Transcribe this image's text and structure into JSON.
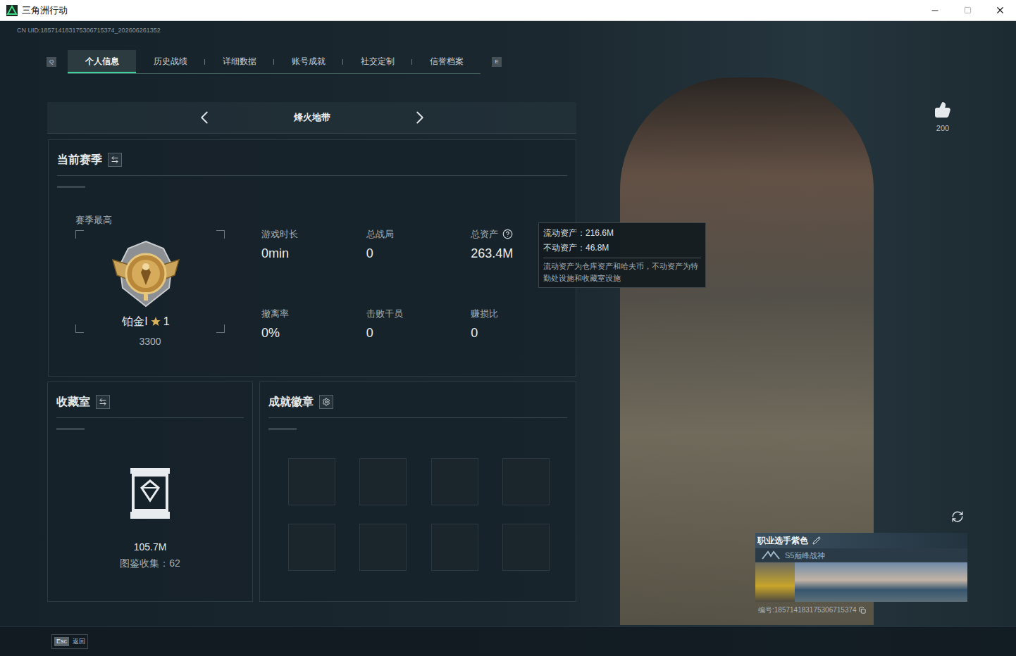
{
  "window": {
    "title": "三角洲行动"
  },
  "uid": "CN UID:185714183175306715374_202606261352",
  "tabs": {
    "prev_key": "Q",
    "next_key": "E",
    "items": [
      {
        "label": "个人信息",
        "selected": true
      },
      {
        "label": "历史战绩",
        "selected": false
      },
      {
        "label": "详细数据",
        "selected": false
      },
      {
        "label": "账号成就",
        "selected": false
      },
      {
        "label": "社交定制",
        "selected": false
      },
      {
        "label": "信誉档案",
        "selected": false
      }
    ]
  },
  "mode": {
    "label": "烽火地带"
  },
  "season": {
    "title": "当前赛季",
    "best_label": "赛季最高",
    "rank": "铂金I",
    "star_count": "1",
    "score": "3300",
    "stats": [
      {
        "label": "游戏时长",
        "value": "0min",
        "help": false
      },
      {
        "label": "总战局",
        "value": "0",
        "help": false
      },
      {
        "label": "总资产",
        "value": "263.4M",
        "help": true
      },
      {
        "label": "撤离率",
        "value": "0%",
        "help": false
      },
      {
        "label": "击败干员",
        "value": "0",
        "help": false
      },
      {
        "label": "赚损比",
        "value": "0",
        "help": false
      }
    ]
  },
  "tooltip": {
    "lines": [
      "流动资产：216.6M",
      "不动资产：46.8M"
    ],
    "note": "流动资产为仓库资产和哈夫币，不动资产为特勤处设施和收藏室设施"
  },
  "collection": {
    "title": "收藏室",
    "value": "105.7M",
    "catalog": "图鉴收集：62"
  },
  "badges": {
    "title": "成就徽章",
    "slots": [
      {
        "filled": false
      },
      {
        "filled": false
      },
      {
        "filled": false
      },
      {
        "filled": false
      },
      {
        "filled": false
      },
      {
        "filled": false
      },
      {
        "filled": false
      },
      {
        "filled": false
      }
    ]
  },
  "likes": "200",
  "card": {
    "name": "职业选手紫色",
    "title": "S5巅峰战神",
    "id": "编号:185714183175306715374"
  },
  "footer": {
    "key": "Esc",
    "label": "返回"
  }
}
